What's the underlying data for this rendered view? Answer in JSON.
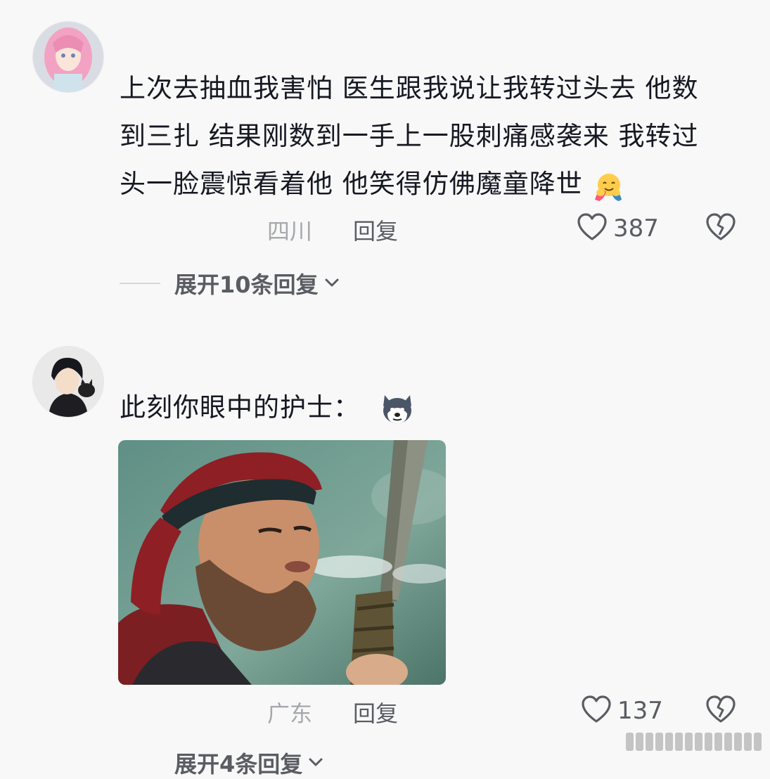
{
  "comments": [
    {
      "text": "上次去抽血我害怕 医生跟我说让我转过头去 他数到三扎 结果刚数到一手上一股刺痛感袭来 我转过头一脸震惊看着他 他笑得仿佛魔童降世",
      "emoji_icon": "hugging-face-icon",
      "location": "四川",
      "reply_label": "回复",
      "like_count": "387",
      "expand_label": "展开10条回复"
    },
    {
      "text": "此刻你眼中的护士：",
      "emoji_icon": "husky-dog-face-icon",
      "image_icon": "sword-wielding-warrior-photo",
      "location": "广东",
      "reply_label": "回复",
      "like_count": "137",
      "expand_label": "展开4条回复"
    }
  ],
  "icons": {
    "like": "heart-outline-icon",
    "dislike": "broken-heart-icon",
    "expand": "chevron-down-icon"
  },
  "colors": {
    "background": "#f8f8f8",
    "text": "#161823",
    "secondary": "#5a5c63",
    "location": "#a6a8ad"
  }
}
